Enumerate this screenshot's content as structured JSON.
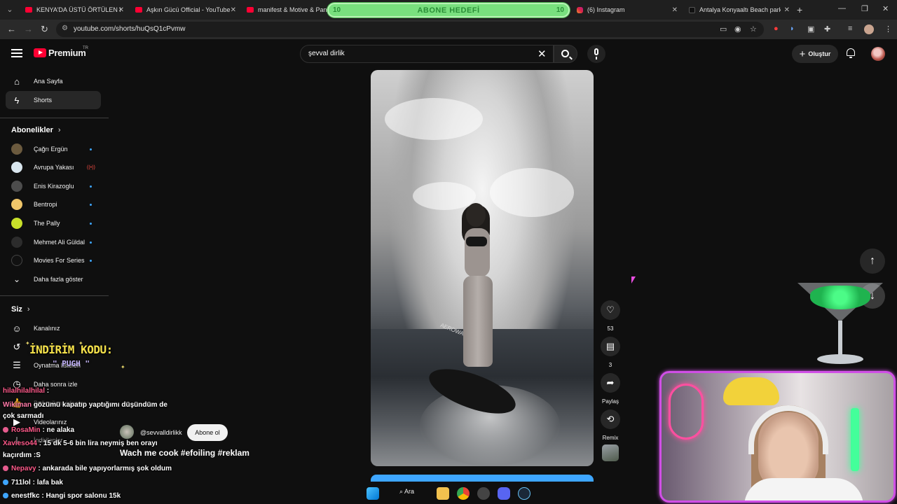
{
  "browser": {
    "tabs": [
      {
        "title": "KENYA'DA ÜSTÜ ÖRTÜLEN KOR",
        "icon": "youtube-icon"
      },
      {
        "title": "Aşkın Gücü Official - YouTube",
        "icon": "youtube-icon"
      },
      {
        "title": "manifest & Motive & Pango",
        "icon": "youtube-icon"
      },
      {
        "title": "(6) Instagram",
        "icon": "instagram-icon"
      },
      {
        "title": "Antalya Konyaaltı Beach parkta",
        "icon": "tiktok-icon"
      }
    ],
    "url": "youtube.com/shorts/huQsQ1cPvmw"
  },
  "overlay": {
    "sub_goal_label": "ABONE HEDEFİ",
    "sub_goal_left": "10",
    "sub_goal_right": "10",
    "promo_title": "İNDİRİM KODU:",
    "promo_code": "\" PUGH \"",
    "chat": [
      {
        "user": "hilalhilalhilal",
        "text": ":"
      },
      {
        "user": "Wikiman",
        "text": "gözümü kapatıp yaptığımı düşündüm de"
      },
      {
        "user": "",
        "text": "çok sarmadı"
      },
      {
        "user": "RosaMin",
        "text": ": ne alaka"
      },
      {
        "user": "Xavieso44",
        "text": ": 15 dk 5-6 bin lira neymiş ben orayı"
      },
      {
        "user": "",
        "text": "kaçırdım :S"
      },
      {
        "user": "Nepavy",
        "text": ": ankarada bile yapıyorlarmış şok oldum"
      },
      {
        "user": "711lol",
        "text": ": lafa bak"
      },
      {
        "user": "enestfkc",
        "text": ": Hangi spor salonu 15k"
      }
    ]
  },
  "header": {
    "logo_text": "Premium",
    "country": "TR",
    "search_value": "şevval dirlik",
    "create_label": "Oluştur"
  },
  "sidebar": {
    "main": [
      {
        "label": "Ana Sayfa",
        "icon": "home-icon"
      },
      {
        "label": "Shorts",
        "icon": "shorts-icon"
      }
    ],
    "subs_heading": "Abonelikler",
    "subscriptions": [
      {
        "name": "Çağrı Ergün",
        "status": "new",
        "color": "#6b5a3e"
      },
      {
        "name": "Avrupa Yakası",
        "status": "live",
        "color": "#d9e6ee"
      },
      {
        "name": "Enis Kirazoglu",
        "status": "new",
        "color": "#4d4d4d"
      },
      {
        "name": "Bentropi",
        "status": "new",
        "color": "#f0c66a"
      },
      {
        "name": "The Pally",
        "status": "new",
        "color": "#c8e02a"
      },
      {
        "name": "Mehmet Ali Güldal",
        "status": "new",
        "color": "#2c2c2c"
      },
      {
        "name": "Movies For Series",
        "status": "new",
        "color": "#111111"
      }
    ],
    "show_more": "Daha fazla göster",
    "you_heading": "Siz",
    "you_items": [
      {
        "label": "Kanalınız",
        "icon": "person-icon"
      },
      {
        "label": "Geçmiş",
        "icon": "history-icon"
      },
      {
        "label": "Oynatma listeleri",
        "icon": "playlist-icon"
      },
      {
        "label": "Daha sonra izle",
        "icon": "clock-icon"
      },
      {
        "label": "Beğenilen videolar",
        "icon": "like-icon"
      },
      {
        "label": "Videolarınız",
        "icon": "video-icon"
      },
      {
        "label": "İndirilenler",
        "icon": "download-icon"
      }
    ]
  },
  "short": {
    "channel": "@sevvalldirlikk",
    "subscribe_label": "Abone ol",
    "title": "Wach me cook #efoiling #reklam",
    "like_count": "53",
    "comment_count": "3",
    "share_label": "Paylaş",
    "remix_label": "Remix",
    "board_text": "AEROWAVE"
  },
  "taskbar": {
    "search_label": "Ara"
  }
}
